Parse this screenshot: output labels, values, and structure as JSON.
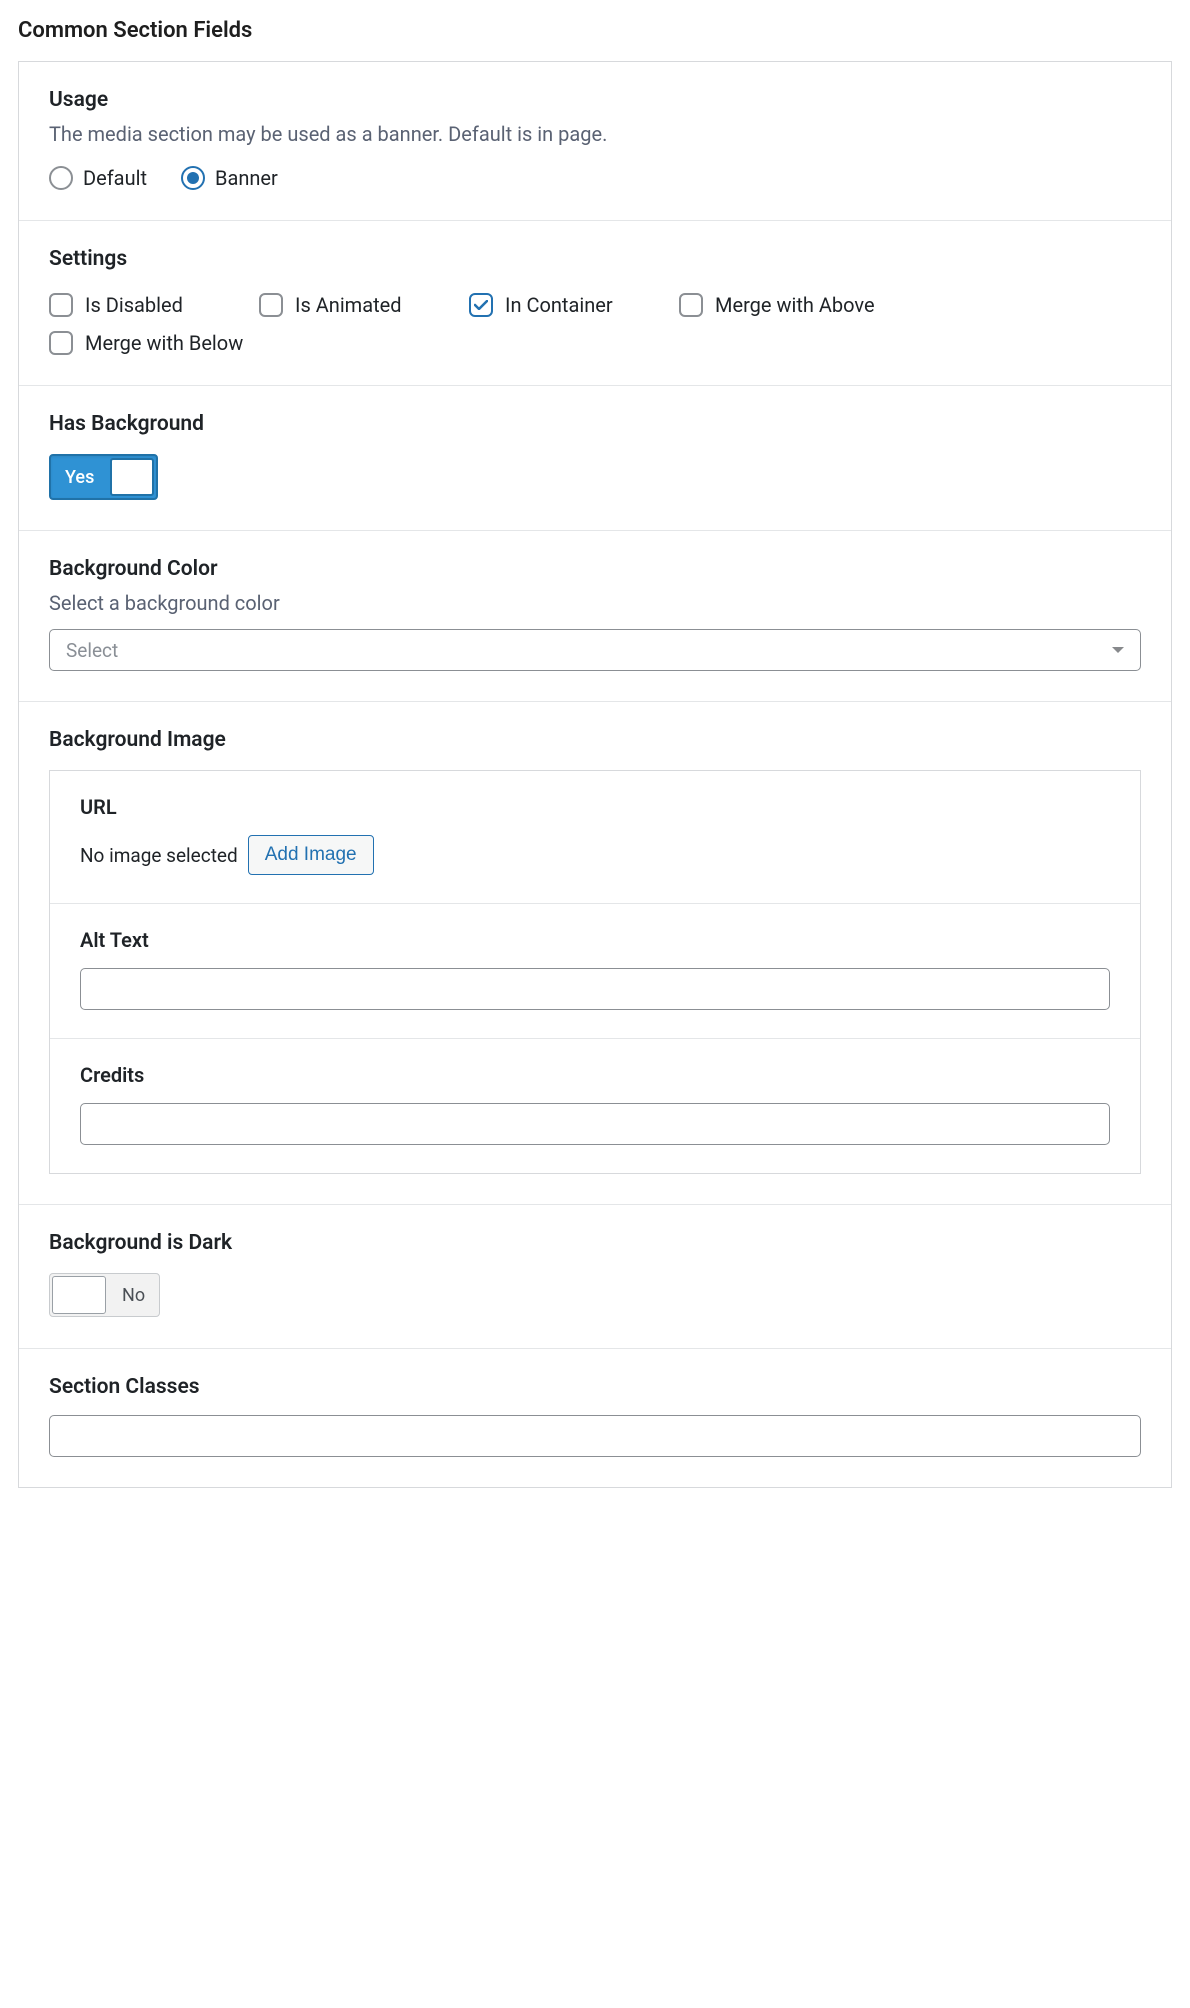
{
  "panel": {
    "title": "Common Section Fields"
  },
  "usage": {
    "label": "Usage",
    "description": "The media section may be used as a banner. Default is in page.",
    "options": {
      "default": "Default",
      "banner": "Banner"
    },
    "selected": "banner"
  },
  "settings": {
    "label": "Settings",
    "options": {
      "isDisabled": {
        "label": "Is Disabled",
        "checked": false
      },
      "isAnimated": {
        "label": "Is Animated",
        "checked": false
      },
      "inContainer": {
        "label": "In Container",
        "checked": true
      },
      "mergeAbove": {
        "label": "Merge with Above",
        "checked": false
      },
      "mergeBelow": {
        "label": "Merge with Below",
        "checked": false
      }
    }
  },
  "hasBackground": {
    "label": "Has Background",
    "value": true,
    "onLabel": "Yes"
  },
  "backgroundColor": {
    "label": "Background Color",
    "description": "Select a background color",
    "placeholder": "Select"
  },
  "backgroundImage": {
    "label": "Background Image",
    "url": {
      "label": "URL",
      "noImageText": "No image selected",
      "addButton": "Add Image"
    },
    "altText": {
      "label": "Alt Text",
      "value": ""
    },
    "credits": {
      "label": "Credits",
      "value": ""
    }
  },
  "backgroundIsDark": {
    "label": "Background is Dark",
    "value": false,
    "offLabel": "No"
  },
  "sectionClasses": {
    "label": "Section Classes",
    "value": ""
  }
}
